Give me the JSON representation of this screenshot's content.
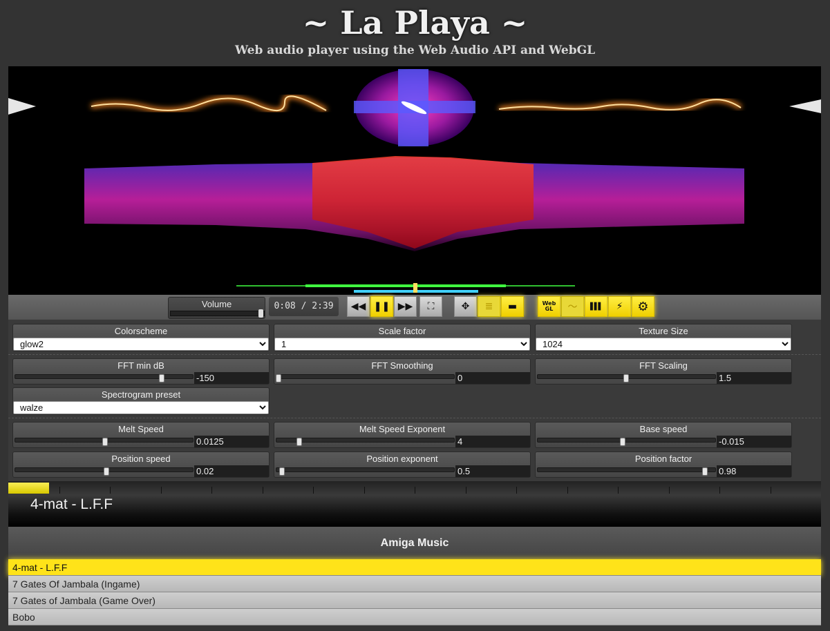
{
  "header": {
    "title": "~ La Playa ~",
    "subtitle": "Web audio player using the Web Audio API and WebGL"
  },
  "transport": {
    "volume_label": "Volume",
    "volume_level": 0.98,
    "time": "0:08 / 2:39",
    "buttons": {
      "rewind": "◀◀",
      "pause": "❚❚",
      "forward": "▶▶",
      "fullscreen": "⛶",
      "move": "✥",
      "spectrum_mode": "≣",
      "bar_mode": "▬",
      "webgl_top": "Web",
      "webgl_bottom": "GL",
      "wave": "〜",
      "bars": "▌▌▌",
      "no_signal": "⚡",
      "settings": "⚙"
    }
  },
  "settings": {
    "colorscheme": {
      "label": "Colorscheme",
      "value": "glow2"
    },
    "scale_factor": {
      "label": "Scale factor",
      "value": "1"
    },
    "texture_size": {
      "label": "Texture Size",
      "value": "1024"
    },
    "fft_min_db": {
      "label": "FFT min dB",
      "value": "-150",
      "level": 0.84
    },
    "fft_smoothing": {
      "label": "FFT Smoothing",
      "value": "0",
      "level": 0.0
    },
    "fft_scaling": {
      "label": "FFT Scaling",
      "value": "1.5",
      "level": 0.5
    },
    "spectrogram_preset": {
      "label": "Spectrogram preset",
      "value": "walze"
    },
    "melt_speed": {
      "label": "Melt Speed",
      "value": "0.0125",
      "level": 0.51
    },
    "melt_speed_exponent": {
      "label": "Melt Speed Exponent",
      "value": "4",
      "level": 0.12
    },
    "base_speed": {
      "label": "Base speed",
      "value": "-0.015",
      "level": 0.48
    },
    "position_speed": {
      "label": "Position speed",
      "value": "0.02",
      "level": 0.52
    },
    "position_exponent": {
      "label": "Position exponent",
      "value": "0.5",
      "level": 0.02
    },
    "position_factor": {
      "label": "Position factor",
      "value": "0.98",
      "level": 0.96
    }
  },
  "progress": {
    "fraction": 0.05
  },
  "now_playing": "4-mat - L.F.F",
  "playlist": {
    "title": "Amiga Music",
    "items": [
      {
        "name": "4-mat - L.F.F",
        "active": true
      },
      {
        "name": "7 Gates Of Jambala (Ingame)",
        "active": false
      },
      {
        "name": "7 Gates of Jambala (Game Over)",
        "active": false
      },
      {
        "name": "Bobo",
        "active": false
      }
    ]
  },
  "colors": {
    "accent": "#ffe319",
    "background": "#333333"
  }
}
